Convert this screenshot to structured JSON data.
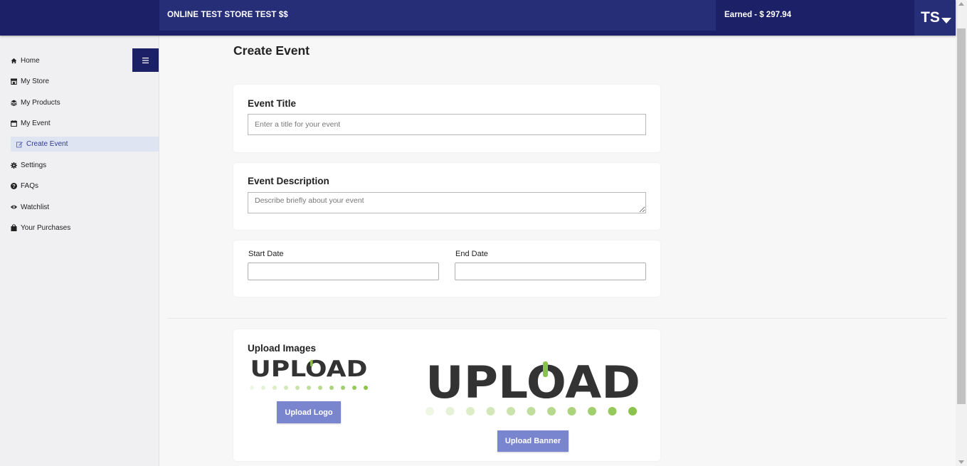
{
  "header": {
    "store_name": "ONLINE TEST STORE TEST $$",
    "earned": "Earned - $ 297.94",
    "avatar_initials": "TS"
  },
  "sidebar": {
    "menu_icon": "hamburger-icon",
    "items": [
      {
        "label": "Home",
        "icon": "home-icon"
      },
      {
        "label": "My Store",
        "icon": "store-icon"
      },
      {
        "label": "My Products",
        "icon": "layers-icon"
      },
      {
        "label": "My Event",
        "icon": "calendar-icon"
      },
      {
        "label": "Create Event",
        "icon": "edit-icon",
        "active": true
      },
      {
        "label": "Settings",
        "icon": "gear-icon"
      },
      {
        "label": "FAQs",
        "icon": "question-icon"
      },
      {
        "label": "Watchlist",
        "icon": "eye-icon"
      },
      {
        "label": "Your Purchases",
        "icon": "bag-icon"
      }
    ]
  },
  "main": {
    "title": "Create Event",
    "event_title": {
      "label": "Event Title",
      "placeholder": "Enter a title for your event",
      "value": ""
    },
    "event_description": {
      "label": "Event Description",
      "placeholder": "Describe briefly about your event",
      "value": ""
    },
    "dates": {
      "start_label": "Start Date",
      "start_value": "",
      "end_label": "End Date",
      "end_value": ""
    },
    "upload": {
      "title": "Upload Images",
      "logo_image_text": "UPLOAD",
      "banner_image_text": "UPLOAD",
      "upload_logo_label": "Upload Logo",
      "upload_banner_label": "Upload Banner"
    }
  },
  "colors": {
    "header_bg": "#1b2067",
    "header_block": "#262e78",
    "button_bg": "#7a85cf",
    "active_nav_bg": "#dfe4f3",
    "upload_green": "#8bc34a"
  }
}
